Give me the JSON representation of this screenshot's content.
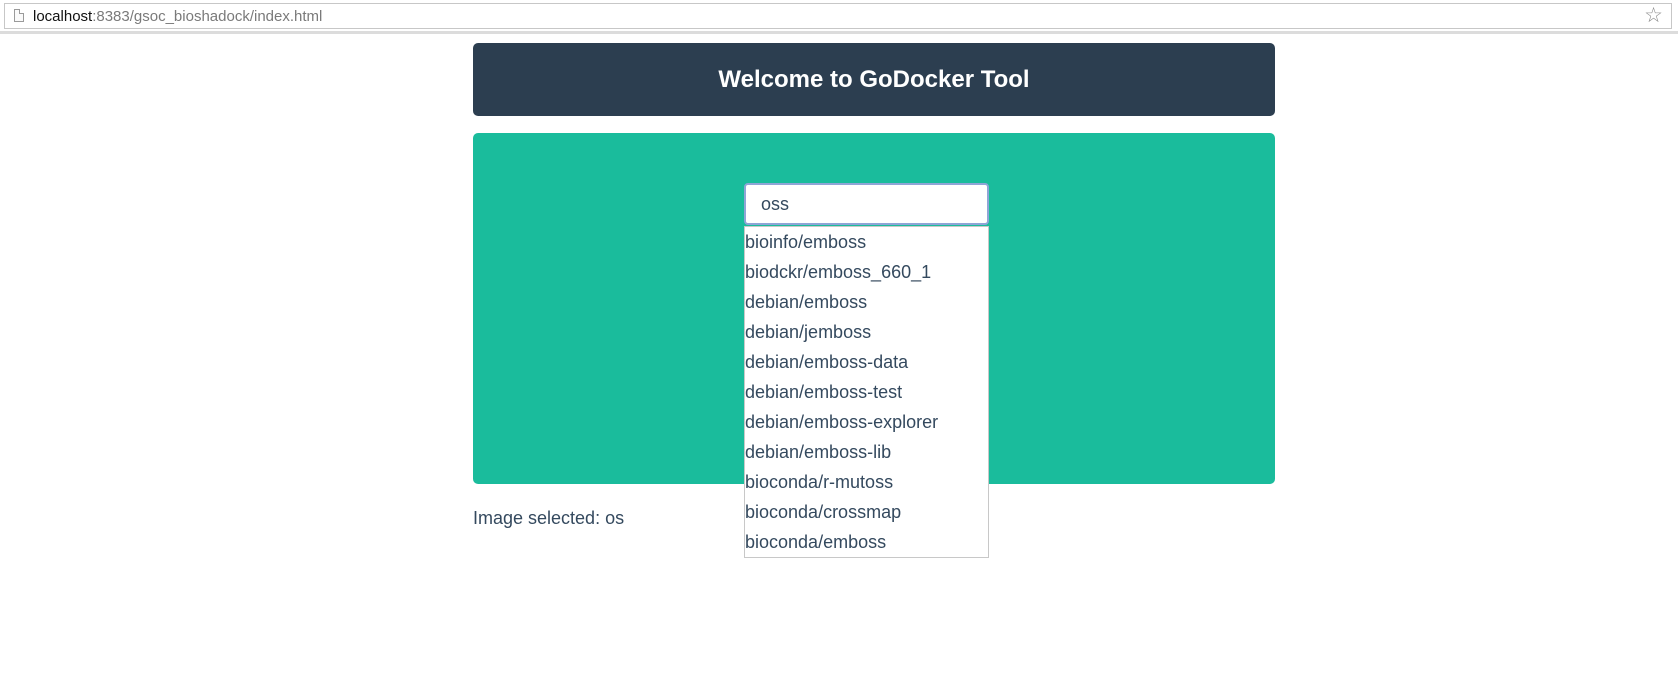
{
  "browser": {
    "url_host": "localhost",
    "url_rest": ":8383/gsoc_bioshadock/index.html",
    "page_icon": "page-icon",
    "bookmark_icon": "star-icon"
  },
  "header": {
    "title": "Welcome to GoDocker Tool"
  },
  "search": {
    "value": "oss",
    "suggestions": [
      "bioinfo/emboss",
      "biodckr/emboss_660_1",
      "debian/emboss",
      "debian/jemboss",
      "debian/emboss-data",
      "debian/emboss-test",
      "debian/emboss-explorer",
      "debian/emboss-lib",
      "bioconda/r-mutoss",
      "bioconda/crossmap",
      "bioconda/emboss"
    ]
  },
  "selection": {
    "text": "Image selected: os"
  },
  "colors": {
    "header_bg": "#2c3e50",
    "panel_bg": "#1abc9c",
    "text": "#34495e"
  }
}
